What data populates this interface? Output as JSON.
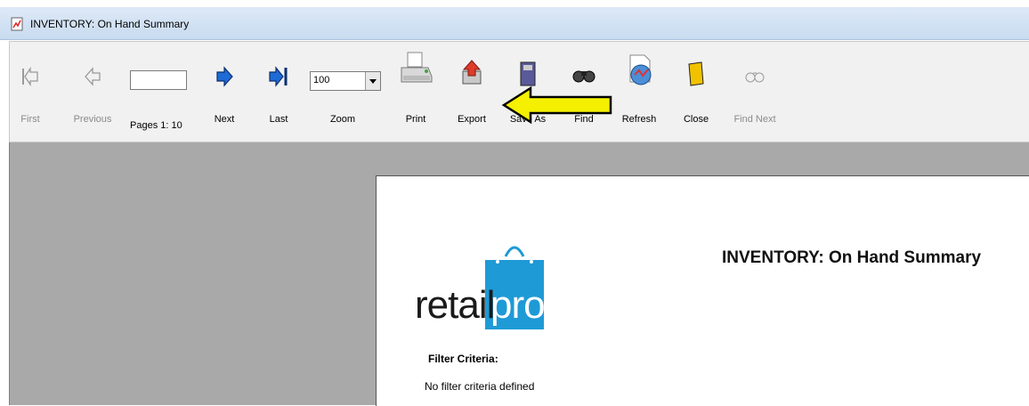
{
  "window": {
    "title": "INVENTORY: On Hand Summary"
  },
  "toolbar": {
    "first_label": "First",
    "previous_label": "Previous",
    "page_input_value": "",
    "pages_label": "Pages 1: 10",
    "next_label": "Next",
    "last_label": "Last",
    "zoom_value": "100",
    "zoom_label": "Zoom",
    "print_label": "Print",
    "export_label": "Export",
    "saveas_label": "Save As",
    "find_label": "Find",
    "refresh_label": "Refresh",
    "close_label": "Close",
    "findnext_label": "Find Next"
  },
  "report": {
    "title": "INVENTORY: On Hand Summary",
    "logo_retail": "retail",
    "logo_pro": "pro",
    "filter_label": "Filter Criteria:",
    "filter_value": "No filter criteria defined"
  },
  "colors": {
    "accent_blue": "#1e9ad6",
    "arrow_yellow": "#f5f000",
    "viewer_bg": "#a9a9a9"
  },
  "icons": [
    "report-app-icon",
    "first-icon",
    "previous-icon",
    "next-icon",
    "last-icon",
    "printer-icon",
    "export-icon",
    "save-as-icon",
    "binoculars-icon",
    "refresh-icon",
    "close-icon",
    "find-next-icon",
    "pointer-arrow-icon"
  ]
}
